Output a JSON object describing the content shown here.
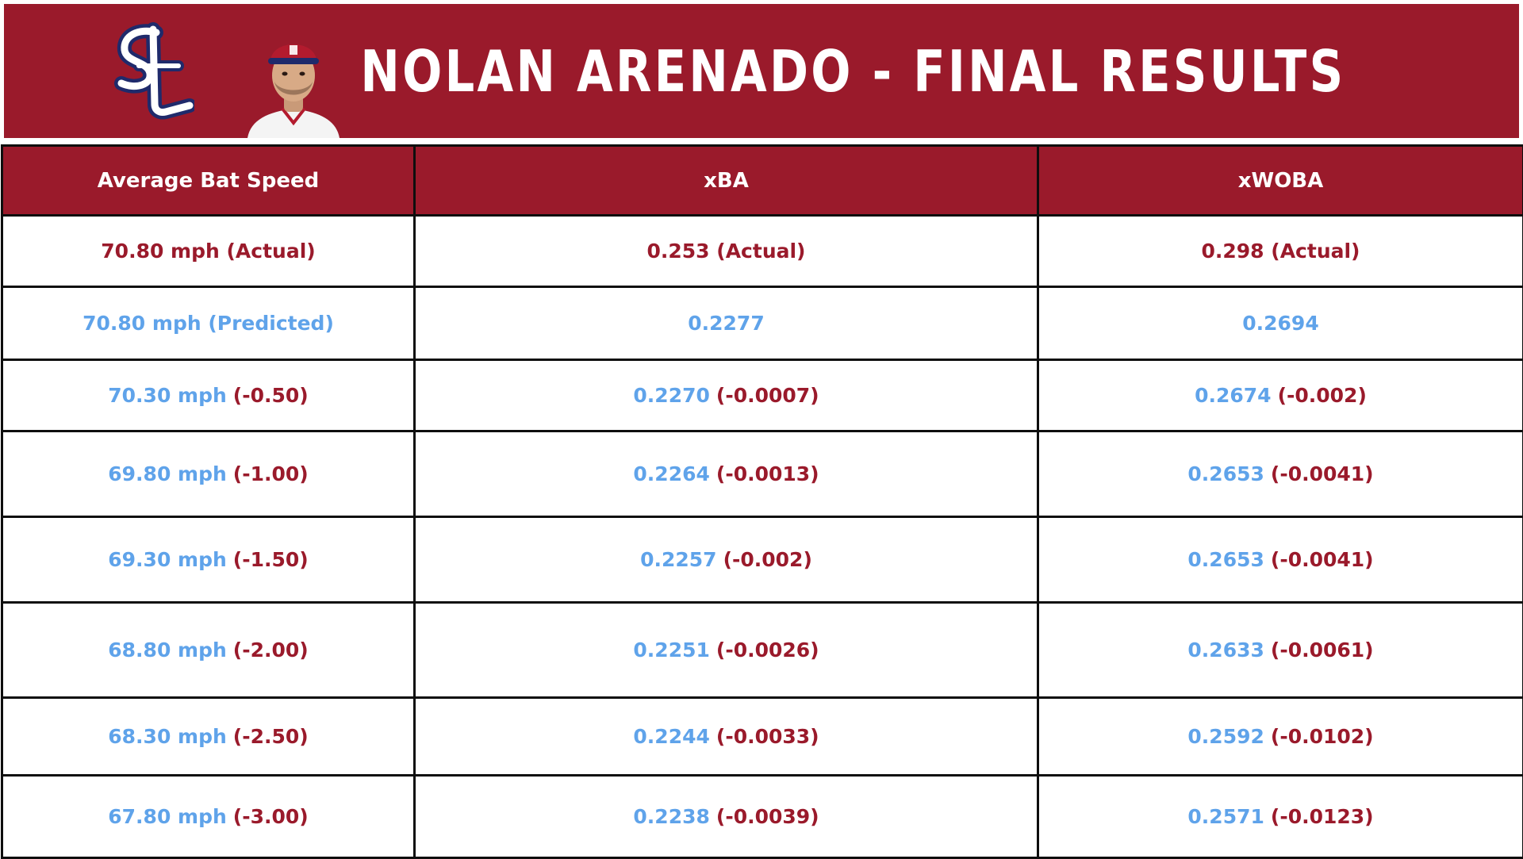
{
  "banner": {
    "title": "NOLAN ARENADO - FINAL RESULTS",
    "logo": "cardinals-stl-logo",
    "photo": "player-headshot"
  },
  "colors": {
    "team_red": "#9a1a2b",
    "predicted_blue": "#5fa3ea",
    "border": "#0e0e0e"
  },
  "table": {
    "headers": [
      "Average Bat Speed",
      "xBA",
      "xWOBA"
    ],
    "actual": {
      "speed": "70.80 mph (Actual)",
      "xba": "0.253 (Actual)",
      "xwoba": "0.298 (Actual)"
    },
    "predicted": {
      "speed": "70.80 mph (Predicted)",
      "xba": "0.2277",
      "xwoba": "0.2694"
    },
    "rows": [
      {
        "speed": "70.30 mph",
        "speed_delta": "(-0.50)",
        "xba": "0.2270",
        "xba_delta": "(-0.0007)",
        "xwoba": "0.2674",
        "xwoba_delta": "(-0.002)"
      },
      {
        "speed": "69.80 mph",
        "speed_delta": "(-1.00)",
        "xba": "0.2264",
        "xba_delta": "(-0.0013)",
        "xwoba": "0.2653",
        "xwoba_delta": "(-0.0041)"
      },
      {
        "speed": "69.30 mph",
        "speed_delta": "(-1.50)",
        "xba": "0.2257",
        "xba_delta": "(-0.002)",
        "xwoba": "0.2653",
        "xwoba_delta": "(-0.0041)"
      },
      {
        "speed": "68.80 mph",
        "speed_delta": "(-2.00)",
        "xba": "0.2251",
        "xba_delta": "(-0.0026)",
        "xwoba": "0.2633",
        "xwoba_delta": "(-0.0061)"
      },
      {
        "speed": "68.30 mph",
        "speed_delta": "(-2.50)",
        "xba": "0.2244",
        "xba_delta": "(-0.0033)",
        "xwoba": "0.2592",
        "xwoba_delta": "(-0.0102)"
      },
      {
        "speed": "67.80 mph",
        "speed_delta": "(-3.00)",
        "xba": "0.2238",
        "xba_delta": "(-0.0039)",
        "xwoba": "0.2571",
        "xwoba_delta": "(-0.0123)"
      }
    ]
  }
}
